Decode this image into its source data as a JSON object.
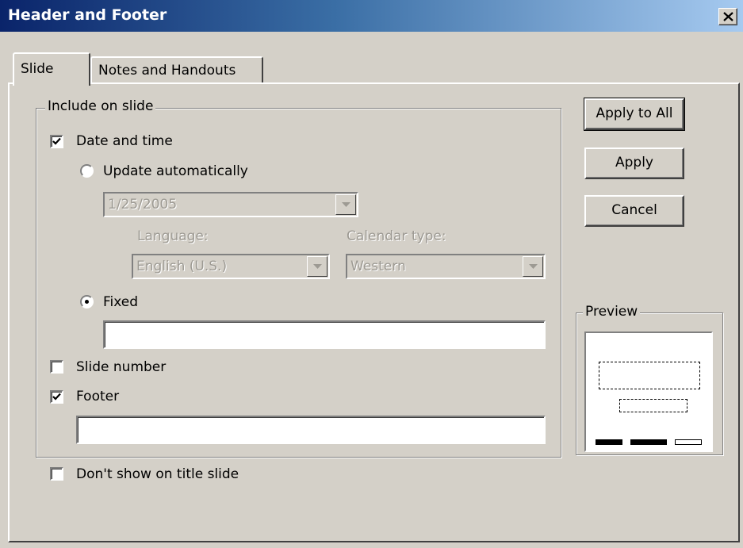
{
  "window": {
    "title": "Header and Footer"
  },
  "tabs": [
    {
      "label": "Slide",
      "selected": true
    },
    {
      "label": "Notes and Handouts",
      "selected": false
    }
  ],
  "include_group": {
    "label": "Include on slide",
    "date_and_time": {
      "label": "Date and time",
      "checked": true
    },
    "update_automatically": {
      "label": "Update automatically",
      "selected": false
    },
    "date_format": {
      "value": "1/25/2005",
      "enabled": false
    },
    "language": {
      "label": "Language:",
      "value": "English (U.S.)",
      "enabled": false
    },
    "calendar_type": {
      "label": "Calendar type:",
      "value": "Western",
      "enabled": false
    },
    "fixed": {
      "label": "Fixed",
      "selected": true,
      "value": ""
    },
    "slide_number": {
      "label": "Slide number",
      "checked": false
    },
    "footer": {
      "label": "Footer",
      "checked": true,
      "value": ""
    }
  },
  "dont_show_title_slide": {
    "label": "Don't show on title slide",
    "checked": false
  },
  "buttons": {
    "apply_to_all": "Apply to All",
    "apply": "Apply",
    "cancel": "Cancel"
  },
  "preview": {
    "label": "Preview"
  },
  "icons": {
    "close": "close-icon",
    "check": "checkmark-icon",
    "dropdown": "chevron-down-icon"
  },
  "colors": {
    "title_bar_start": "#0a246a",
    "title_bar_end": "#a6caf0",
    "dialog_face": "#d4d0c8",
    "disabled_text": "#9d9a93"
  }
}
